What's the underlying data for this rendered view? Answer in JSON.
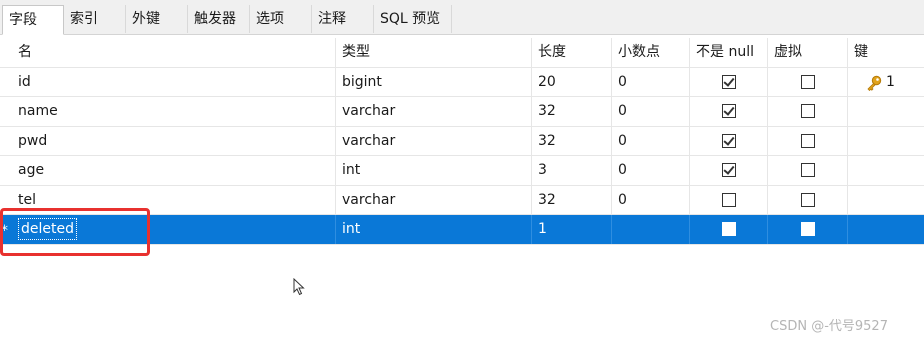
{
  "tabs": [
    {
      "label": "字段",
      "active": true
    },
    {
      "label": "索引",
      "active": false
    },
    {
      "label": "外键",
      "active": false
    },
    {
      "label": "触发器",
      "active": false
    },
    {
      "label": "选项",
      "active": false
    },
    {
      "label": "注释",
      "active": false
    },
    {
      "label": "SQL 预览",
      "active": false
    }
  ],
  "columns": {
    "name": "名",
    "type": "类型",
    "length": "长度",
    "decimals": "小数点",
    "not_null": "不是 null",
    "virtual": "虚拟",
    "key": "键"
  },
  "rows": [
    {
      "name": "id",
      "type": "bigint",
      "length": "20",
      "decimals": "0",
      "not_null": true,
      "virtual": false,
      "key": "1"
    },
    {
      "name": "name",
      "type": "varchar",
      "length": "32",
      "decimals": "0",
      "not_null": true,
      "virtual": false,
      "key": ""
    },
    {
      "name": "pwd",
      "type": "varchar",
      "length": "32",
      "decimals": "0",
      "not_null": true,
      "virtual": false,
      "key": ""
    },
    {
      "name": "age",
      "type": "int",
      "length": "3",
      "decimals": "0",
      "not_null": true,
      "virtual": false,
      "key": ""
    },
    {
      "name": "tel",
      "type": "varchar",
      "length": "32",
      "decimals": "0",
      "not_null": false,
      "virtual": false,
      "key": ""
    },
    {
      "name": "deleted",
      "type": "int",
      "length": "1",
      "decimals": "",
      "not_null": false,
      "virtual": false,
      "key": "",
      "selected": true,
      "marker": "*"
    }
  ],
  "key_icon": "key-icon",
  "selection_color": "#0a78d7",
  "annotation_color": "#e8312f",
  "watermark": "CSDN @-代号9527"
}
